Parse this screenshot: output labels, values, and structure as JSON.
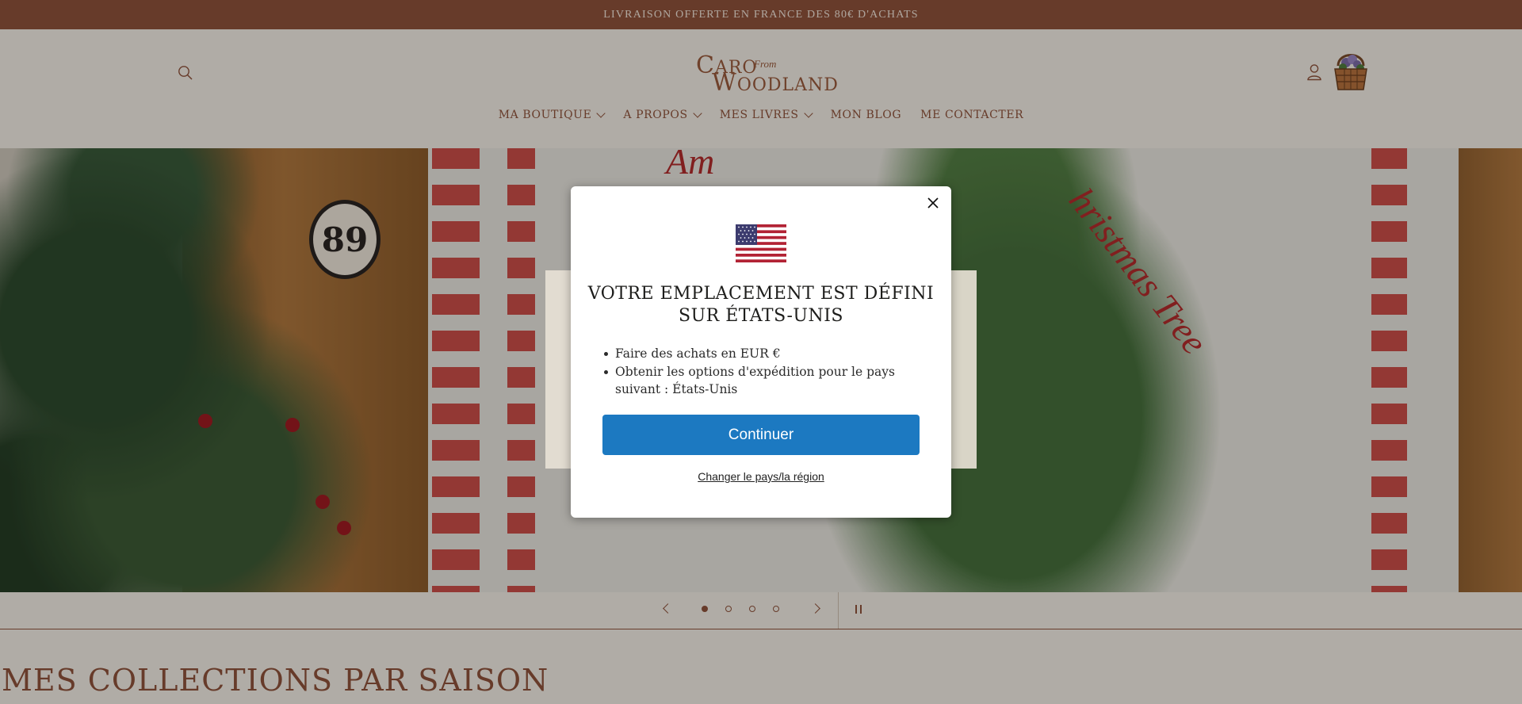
{
  "announcement": {
    "text": "LIVRAISON OFFERTE EN FRANCE DES 80€ D'ACHATS"
  },
  "header": {
    "logo": {
      "line1_big": "C",
      "line1_small": "ARO",
      "from": "From",
      "line2_big": "W",
      "line2_small": "OODLAND"
    },
    "icons": {
      "search": "search-icon",
      "account": "user-icon",
      "cart": "basket-cart-icon"
    }
  },
  "nav": {
    "items": [
      {
        "label": "MA BOUTIQUE",
        "dropdown": true
      },
      {
        "label": "A PROPOS",
        "dropdown": true
      },
      {
        "label": "MES LIVRES",
        "dropdown": true
      },
      {
        "label": "MON BLOG",
        "dropdown": false
      },
      {
        "label": "ME CONTACTER",
        "dropdown": false
      }
    ]
  },
  "hero": {
    "plate_number": "89",
    "script_left": "Am",
    "script_right": "hristmas Tree"
  },
  "slideshow": {
    "slides": 4,
    "active": 1
  },
  "section": {
    "title": "MES COLLECTIONS PAR SAISON"
  },
  "modal": {
    "title": "VOTRE EMPLACEMENT EST DÉFINI SUR ÉTATS-UNIS",
    "bullets": [
      "Faire des achats en EUR €",
      "Obtenir les options d'expédition pour le pays suivant : États-Unis"
    ],
    "continue_label": "Continuer",
    "change_label": "Changer le pays/la région"
  },
  "colors": {
    "accent": "#8f533b",
    "button": "#1c79c1",
    "background": "#f4efe6"
  }
}
